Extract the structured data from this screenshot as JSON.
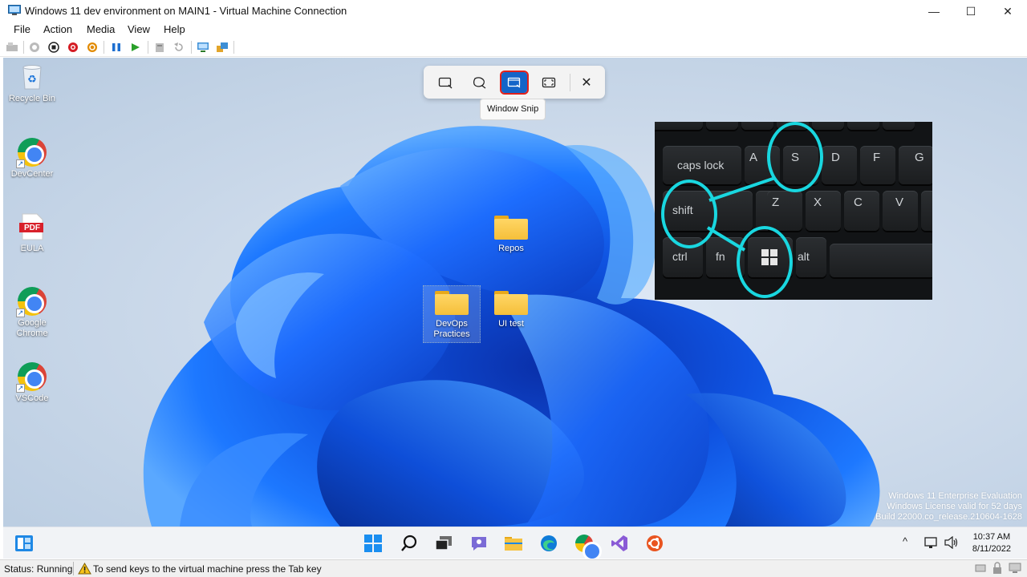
{
  "window": {
    "title": "Windows 11 dev environment on MAIN1 - Virtual Machine Connection",
    "controls": {
      "minimize": "—",
      "maximize": "☐",
      "close": "✕"
    }
  },
  "menu": [
    "File",
    "Action",
    "Media",
    "View",
    "Help"
  ],
  "toolbar_icons": [
    "ctrl-alt-del-icon",
    "start-icon",
    "turn-off-icon",
    "shutdown-icon",
    "save-icon",
    "pause-icon",
    "resume-icon",
    "checkpoint-icon",
    "revert-icon",
    "enhanced-session-icon",
    "share-icon"
  ],
  "desktop_icons": [
    {
      "label": "Recycle Bin",
      "icon": "recycle-bin-icon"
    },
    {
      "label": "DevCenter",
      "icon": "chrome-icon"
    },
    {
      "label": "EULA",
      "icon": "pdf-icon",
      "badge": "PDF"
    },
    {
      "label": "Google Chrome",
      "icon": "chrome-icon"
    },
    {
      "label": "VSCode",
      "icon": "chrome-icon"
    }
  ],
  "folders": [
    {
      "label": "Repos"
    },
    {
      "label": "DevOps Practices"
    },
    {
      "label": "UI test"
    }
  ],
  "snip_toolbar": {
    "modes": [
      "rectangle-snip-icon",
      "freeform-snip-icon",
      "window-snip-icon",
      "fullscreen-snip-icon"
    ],
    "active_mode": "Window Snip",
    "close": "✕",
    "tooltip": "Window Snip"
  },
  "keyboard_overlay": {
    "keys": [
      "caps lock",
      "A",
      "S",
      "D",
      "F",
      "G",
      "shift",
      "Z",
      "X",
      "C",
      "V",
      "ctrl",
      "fn",
      "alt"
    ],
    "highlight_color": "#19d7e0",
    "highlighted": [
      "shift",
      "S",
      "windows-key"
    ]
  },
  "watermark": {
    "line1": "Windows 11 Enterprise Evaluation",
    "line2": "Windows License valid for 52 days",
    "line3": "Build 22000.co_release.210604-1628"
  },
  "taskbar": {
    "apps": [
      "widgets-icon",
      "start-icon",
      "search-icon",
      "task-view-icon",
      "teams-chat-icon",
      "file-explorer-icon",
      "edge-icon",
      "chrome-icon",
      "visual-studio-icon",
      "ubuntu-icon"
    ],
    "tray": {
      "chevron": "^",
      "time": "10:37 AM",
      "date": "8/11/2022"
    }
  },
  "status": {
    "state": "Status: Running",
    "hint": "To send keys to the virtual machine press the Tab key"
  }
}
